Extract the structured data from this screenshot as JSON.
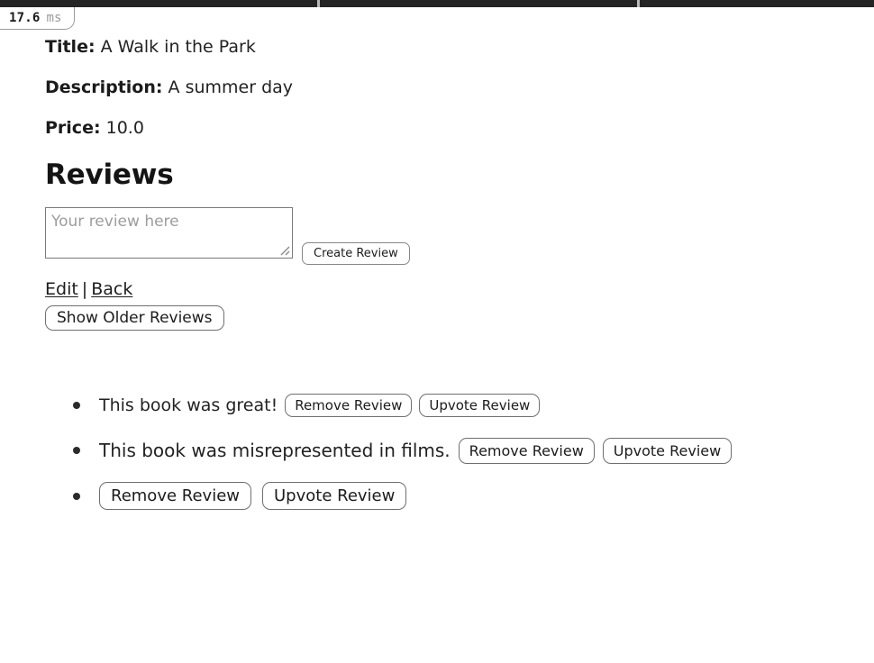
{
  "topbar": {
    "segments": [
      352,
      355,
      263
    ],
    "bar_color": "#242424",
    "separator_color": "#b9b9b9"
  },
  "perf_badge": {
    "name": "render-time-badge",
    "value": "17.6",
    "unit": "ms"
  },
  "book": {
    "title_label": "Title:",
    "title_value": "A Walk in the Park",
    "description_label": "Description:",
    "description_value": "A summer day",
    "price_label": "Price:",
    "price_value": "10.0"
  },
  "reviews_section": {
    "heading": "Reviews",
    "composer": {
      "textarea_placeholder": "Your review here",
      "textarea_value": "",
      "create_button_label": "Create Review",
      "resize_grip_icon": "resize-grip-icon"
    },
    "links": {
      "edit_label": "Edit",
      "separator": "|",
      "back_label": "Back"
    },
    "show_older_button_label": "Show Older Reviews",
    "items": [
      {
        "text": "This book was great!",
        "remove_label": "Remove Review",
        "upvote_label": "Upvote Review",
        "size_class": "sz-1"
      },
      {
        "text": "This book was misrepresented in films.",
        "remove_label": "Remove Review",
        "upvote_label": "Upvote Review",
        "size_class": "sz-2"
      },
      {
        "text": "",
        "remove_label": "Remove Review",
        "upvote_label": "Upvote Review",
        "size_class": "sz-3"
      }
    ]
  }
}
